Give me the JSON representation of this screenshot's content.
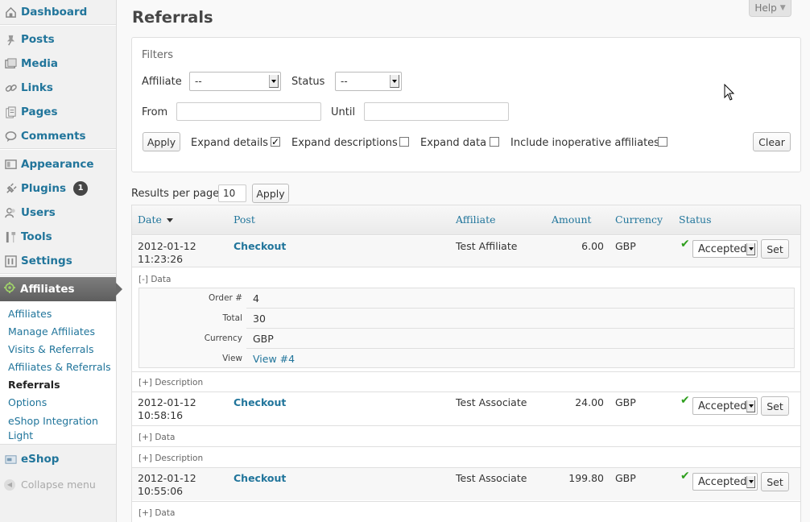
{
  "sidebar": {
    "items": [
      {
        "label": "Dashboard",
        "icon": "dashboard-icon"
      },
      {
        "label": "Posts",
        "icon": "pin-icon"
      },
      {
        "label": "Media",
        "icon": "media-icon"
      },
      {
        "label": "Links",
        "icon": "link-icon"
      },
      {
        "label": "Pages",
        "icon": "pages-icon"
      },
      {
        "label": "Comments",
        "icon": "comment-icon"
      },
      {
        "label": "Appearance",
        "icon": "appearance-icon"
      },
      {
        "label": "Plugins",
        "icon": "plugin-icon",
        "badge": "1"
      },
      {
        "label": "Users",
        "icon": "users-icon"
      },
      {
        "label": "Tools",
        "icon": "tools-icon"
      },
      {
        "label": "Settings",
        "icon": "settings-icon"
      }
    ],
    "affiliates": {
      "label": "Affiliates",
      "submenu": [
        "Affiliates",
        "Manage Affiliates",
        "Visits & Referrals",
        "Affiliates & Referrals",
        "Referrals",
        "Options",
        "eShop Integration Light"
      ],
      "current": "Referrals"
    },
    "eshop": "eShop",
    "collapse": "Collapse menu"
  },
  "page": {
    "title": "Referrals",
    "help": "Help"
  },
  "filters": {
    "heading": "Filters",
    "affiliate_label": "Affiliate",
    "affiliate_value": "--",
    "status_label": "Status",
    "status_value": "--",
    "from_label": "From",
    "until_label": "Until",
    "apply": "Apply",
    "expand_details": "Expand details",
    "expand_details_checked": true,
    "expand_descriptions": "Expand descriptions",
    "expand_data": "Expand data",
    "include_inoperative": "Include inoperative affiliates",
    "clear": "Clear"
  },
  "results": {
    "per_page_label": "Results per page",
    "per_page_value": "10",
    "apply": "Apply"
  },
  "table": {
    "columns": [
      "Date",
      "Post",
      "Affiliate",
      "Amount",
      "Currency",
      "Status"
    ],
    "rows": [
      {
        "date": "2012-01-12",
        "time": "11:23:26",
        "post": "Checkout",
        "affiliate": "Test Affiliate",
        "amount": "6.00",
        "currency": "GBP",
        "status": "Accepted",
        "set": "Set",
        "data_toggle": "[-] Data",
        "desc_toggle": "[+] Description"
      },
      {
        "date": "2012-01-12",
        "time": "10:58:16",
        "post": "Checkout",
        "affiliate": "Test Associate",
        "amount": "24.00",
        "currency": "GBP",
        "status": "Accepted",
        "set": "Set",
        "data_toggle": "[+] Data",
        "desc_toggle": "[+] Description"
      },
      {
        "date": "2012-01-12",
        "time": "10:55:06",
        "post": "Checkout",
        "affiliate": "Test Associate",
        "amount": "199.80",
        "currency": "GBP",
        "status": "Accepted",
        "set": "Set",
        "data_toggle": "[+] Data"
      }
    ],
    "data_details": [
      {
        "label": "Order #",
        "value": "4"
      },
      {
        "label": "Total",
        "value": "30"
      },
      {
        "label": "Currency",
        "value": "GBP"
      },
      {
        "label": "View",
        "value": "View #4"
      }
    ]
  },
  "colors": {
    "link": "#21759b",
    "accept": "#2e9f1e",
    "menu_active": "#6a6a6a"
  }
}
